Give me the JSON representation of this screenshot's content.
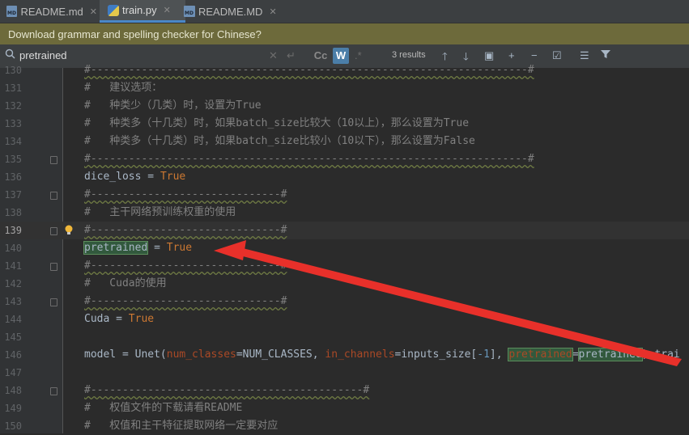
{
  "tabs": [
    {
      "label": "README.md",
      "icon": "md-file-icon",
      "active": false
    },
    {
      "label": "train.py",
      "icon": "python-file-icon",
      "active": true
    },
    {
      "label": "README.MD",
      "icon": "md-file-icon",
      "active": false
    }
  ],
  "banner": {
    "text": "Download grammar and spelling checker for Chinese?"
  },
  "find": {
    "query": "pretrained",
    "results": "3 results",
    "match_case_label": "Cc",
    "words_label": "W",
    "regex_label": ".*"
  },
  "lines": [
    {
      "num": "130",
      "text": "#---------------------------------------------------------------------#"
    },
    {
      "num": "131",
      "text": "#   建议选项："
    },
    {
      "num": "132",
      "text": "#   种类少（几类）时，设置为True"
    },
    {
      "num": "133",
      "text": "#   种类多（十几类）时，如果batch_size比较大（10以上），那么设置为True"
    },
    {
      "num": "134",
      "text": "#   种类多（十几类）时，如果batch_size比较小（10以下），那么设置为False"
    },
    {
      "num": "135",
      "text": "#---------------------------------------------------------------------#"
    },
    {
      "num": "136",
      "name": "dice_loss",
      "op": " = ",
      "value": "True"
    },
    {
      "num": "137",
      "text": "#------------------------------#"
    },
    {
      "num": "138",
      "text": "#   主干网络预训练权重的使用"
    },
    {
      "num": "139",
      "text": "#------------------------------#"
    },
    {
      "num": "140",
      "name": "pretrained",
      "op": " = ",
      "value": "True"
    },
    {
      "num": "141",
      "text": "#------------------------------#"
    },
    {
      "num": "142",
      "text": "#   Cuda的使用"
    },
    {
      "num": "143",
      "text": "#------------------------------#"
    },
    {
      "num": "144",
      "name": "Cuda",
      "op": " = ",
      "value": "True"
    },
    {
      "num": "145",
      "text": ""
    },
    {
      "num": "146",
      "model": {
        "a": "model = Unet(",
        "p1": "num_classes",
        "e1": "=NUM_CLASSES, ",
        "p2": "in_channels",
        "e2": "=inputs_size[",
        "n": "-1",
        "e3": "], ",
        "p3": "pretrained",
        "e4": "=",
        "p4": "pretrained",
        "e5": ").trai"
      }
    },
    {
      "num": "147",
      "text": ""
    },
    {
      "num": "148",
      "text": "#-------------------------------------------#"
    },
    {
      "num": "149",
      "text": "#   权值文件的下载请看README"
    },
    {
      "num": "150",
      "text": "#   权值和主干特征提取网络一定要对应"
    }
  ],
  "colors": {
    "arrow": "#e8302a",
    "search_highlight": "#32593d"
  }
}
